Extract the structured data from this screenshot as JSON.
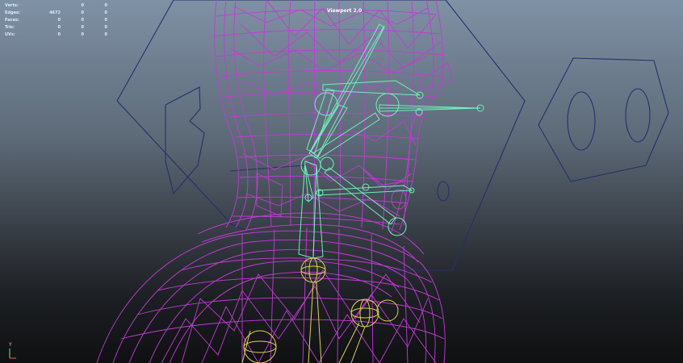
{
  "viewport": {
    "label": "Viewport 2.0"
  },
  "hud": {
    "rows": [
      {
        "label": "Verts:",
        "values": [
          "",
          "0",
          "0"
        ]
      },
      {
        "label": "Edges:",
        "values": [
          "4672",
          "0",
          "0"
        ]
      },
      {
        "label": "Faces:",
        "values": [
          "0",
          "0",
          "0"
        ]
      },
      {
        "label": "Tris:",
        "values": [
          "0",
          "0",
          "0"
        ]
      },
      {
        "label": "UVs:",
        "values": [
          "0",
          "0",
          "0"
        ]
      }
    ]
  },
  "axis": {
    "y_label": "Y"
  },
  "colors": {
    "mesh_wire": "#c43ad8",
    "bone": "#6ef0b8",
    "nurbs_curve": "#24306b",
    "yellow_joint": "#e0d24a"
  }
}
